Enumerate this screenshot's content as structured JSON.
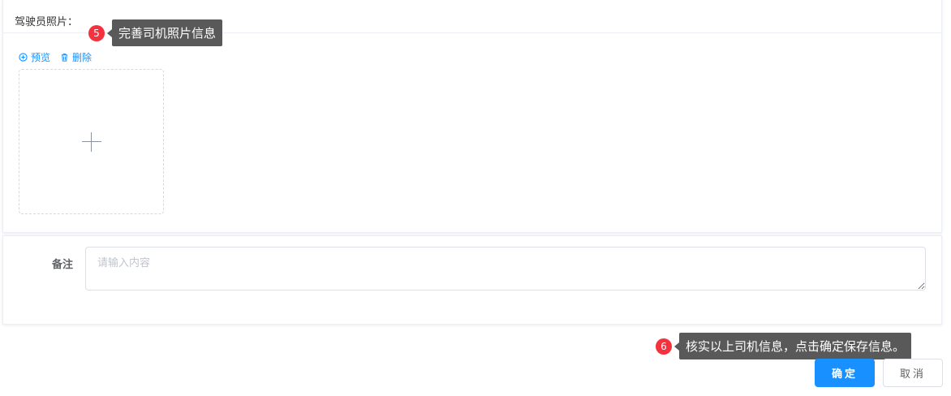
{
  "photo_section": {
    "title": "驾驶员照片：",
    "preview_label": "预览",
    "delete_label": "删除",
    "upload_icon": "plus-icon"
  },
  "remark": {
    "label": "备注",
    "placeholder": "请输入内容",
    "value": ""
  },
  "tips": [
    {
      "number": "5",
      "text": "完善司机照片信息"
    },
    {
      "number": "6",
      "text": "核实以上司机信息，点击确定保存信息。"
    }
  ],
  "buttons": {
    "confirm": "确定",
    "cancel": "取消"
  },
  "colors": {
    "primary": "#1890ff",
    "tip_badge": "#f5313d",
    "tip_bg": "#595959"
  }
}
